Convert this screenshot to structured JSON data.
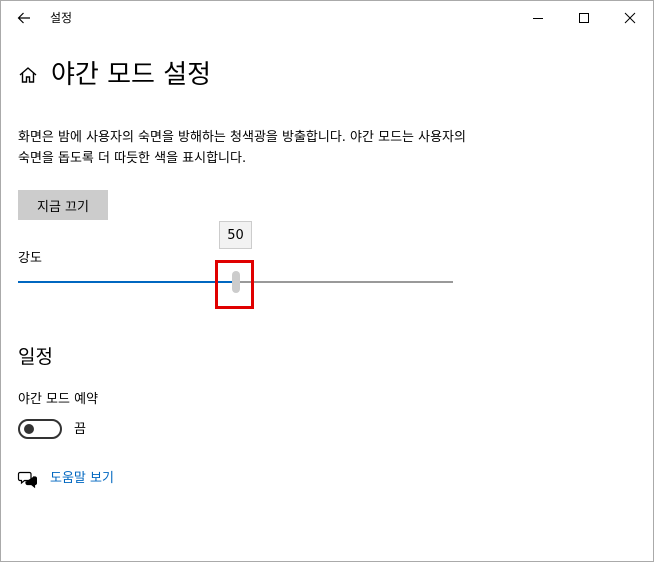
{
  "titlebar": {
    "title": "설정",
    "back_icon": "back-arrow-icon",
    "minimize_icon": "minimize-icon",
    "maximize_icon": "maximize-icon",
    "close_icon": "close-icon"
  },
  "header": {
    "icon": "home-icon",
    "title": "야간 모드 설정"
  },
  "description": "화면은 밤에 사용자의 숙면을 방해하는 청색광을 방출합니다. 야간 모드는 사용자의 숙면을 돕도록 더 따듯한 색을 표시합니다.",
  "action_button": {
    "label": "지금 끄기"
  },
  "intensity": {
    "label": "강도",
    "value": 50,
    "min": 0,
    "max": 100,
    "tooltip": "50"
  },
  "schedule": {
    "title": "일정",
    "toggle_label": "야간 모드 예약",
    "toggle_on": false,
    "toggle_state_text": "끔"
  },
  "help": {
    "icon": "help-chat-icon",
    "link": "도움말 보기"
  },
  "colors": {
    "accent": "#0067c0",
    "focus": "#e00000",
    "button_bg": "#cccccc"
  }
}
